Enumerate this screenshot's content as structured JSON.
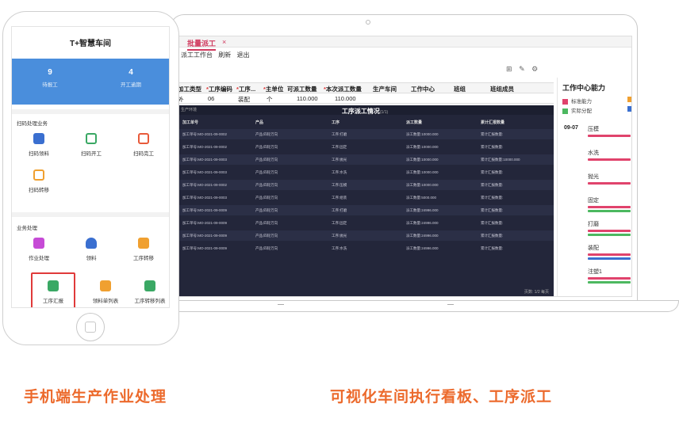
{
  "laptop": {
    "tab_label": "批量派工",
    "tab_close": "×",
    "menu": [
      "派工工作台",
      "刷新",
      "退出"
    ],
    "toolbar_icons": [
      "filter-icon",
      "edit-icon",
      "settings-icon"
    ],
    "columns": [
      "加工类型",
      "工序编码",
      "工序...",
      "主单位",
      "可派工数量",
      "本次派工数量",
      "生产车间",
      "工作中心",
      "班组",
      "班组成员"
    ],
    "required_columns": [
      "工序编码",
      "工序...",
      "主单位",
      "本次派工数量"
    ],
    "row": [
      "外",
      "06",
      "装配",
      "个",
      "110.000",
      "110.000"
    ],
    "dashboard": {
      "sub": "生产环境",
      "title": "工序派工情况",
      "title_suffix": "(1/1)",
      "headers": [
        "加工单号",
        "产品",
        "工序",
        "派工数量",
        "累计汇报数量"
      ],
      "rows": [
        [
          "加工单号:MO-2021-09-0002",
          "产品:四轮万向",
          "工序:打磨",
          "派工数量:10000.000",
          "累计汇报数量:"
        ],
        [
          "加工单号:MO-2021-09-0002",
          "产品:四轮万向",
          "工序:固定",
          "派工数量:10000.000",
          "累计汇报数量:"
        ],
        [
          "加工单号:MO-2021-09-0003",
          "产品:四轮万向",
          "工序:抛光",
          "派工数量:10000.000",
          "累计汇报数量:10000.000"
        ],
        [
          "加工单号:MO-2021-09-0003",
          "产品:四轮万向",
          "工序:水洗",
          "派工数量:10000.000",
          "累计汇报数量:"
        ],
        [
          "加工单号:MO-2021-09-0002",
          "产品:四轮万向",
          "工序:压模",
          "派工数量:10000.000",
          "累计汇报数量:"
        ],
        [
          "加工单号:MO-2021-09-0003",
          "产品:四轮万向",
          "工序:组装",
          "派工数量:5000.000",
          "累计汇报数量:"
        ],
        [
          "加工单号:MO-2021-09-0009",
          "产品:四轮万向",
          "工序:打磨",
          "派工数量:24996.000",
          "累计汇报数量:"
        ],
        [
          "加工单号:MO-2021-09-0009",
          "产品:四轮万向",
          "工序:固定",
          "派工数量:24996.000",
          "累计汇报数量:"
        ],
        [
          "加工单号:MO-2021-09-0009",
          "产品:四轮万向",
          "工序:抛光",
          "派工数量:24996.000",
          "累计汇报数量:"
        ],
        [
          "加工单号:MO-2021-09-0009",
          "产品:四轮万向",
          "工序:水洗",
          "派工数量:24996.000",
          "累计汇报数量:"
        ]
      ],
      "footer": "页数: 1/2 每页"
    },
    "side": {
      "title": "工作中心能力",
      "legend_standard": "标准能力",
      "legend_actual": "实际分配",
      "date": "09-07",
      "centers": [
        "压模",
        "水洗",
        "抛光",
        "固定",
        "打磨",
        "装配",
        "注塑1"
      ],
      "colors": {
        "standard": "#e0436c",
        "actual": "#4cb860",
        "orange": "#f0a030",
        "blue": "#3a6fd0"
      }
    }
  },
  "phone": {
    "title": "T+智慧车间",
    "stats": [
      {
        "num": "9",
        "label": "待报工"
      },
      {
        "num": "4",
        "label": "开工逾期"
      }
    ],
    "section_scan": "扫码处理业务",
    "scan_tiles": [
      "扫码领料",
      "扫码开工",
      "扫码完工",
      "扫码转移"
    ],
    "section_biz": "业务处理",
    "biz_tiles": [
      "作业处理",
      "领料",
      "工序转移",
      "工序汇报",
      "领料单列表",
      "工序转移列表"
    ]
  },
  "captions": {
    "left": "手机端生产作业处理",
    "right": "可视化车间执行看板、工序派工"
  }
}
